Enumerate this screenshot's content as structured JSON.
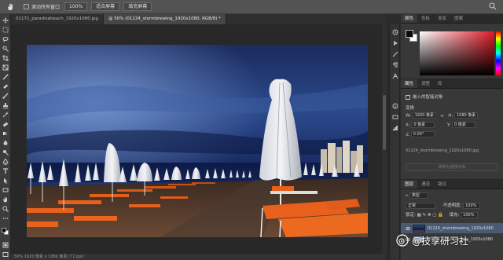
{
  "options_bar": {
    "scroll_all_label": "滚动所有窗口",
    "zoom_value": "100%",
    "fit_screen_label": "适合屏幕",
    "fill_screen_label": "填充屏幕"
  },
  "tabs": [
    {
      "label": "01171_paradisebeach_1920x1080.jpg"
    },
    {
      "label": "@ 50% (01224_stormbrewing_1920x1080, RGB/8) *"
    }
  ],
  "status_bar": {
    "text": "50%   1920 像素 x 1080 像素 (72 ppi)"
  },
  "color_panel": {
    "tabs": [
      "颜色",
      "色板",
      "渐变",
      "图案"
    ],
    "foreground": "#0a0a0a",
    "background": "#ffffff"
  },
  "properties_panel": {
    "tabs": [
      "属性",
      "调整",
      "库"
    ],
    "object_type": "嵌入的智能对象",
    "section": "变换",
    "w_label": "W:",
    "w_value": "1920 像素",
    "h_label": "H:",
    "h_value": "1080 像素",
    "x_label": "X:",
    "x_value": "0 像素",
    "y_label": "Y:",
    "y_value": "0 像素",
    "angle": "0.00°",
    "file": "01224_stormbrewing_1920x1080.jpg",
    "disabled_button": "转换为链接对象"
  },
  "layers_panel": {
    "tabs": [
      "图层",
      "通道",
      "路径"
    ],
    "kind_label": "类型",
    "blend_mode": "正常",
    "opacity_label": "不透明度:",
    "opacity_value": "100%",
    "lock_label": "锁定:",
    "fill_label": "填充:",
    "fill_value": "100%",
    "layers": [
      {
        "name": "01224_stormbrewing_1920x1080"
      },
      {
        "name": "01225_saturday...ing_1920x1080"
      }
    ]
  },
  "watermark": {
    "text": "@技享研习社"
  },
  "colors": {
    "accent_selection": "#4b5a73",
    "panel_bg": "#383838"
  }
}
